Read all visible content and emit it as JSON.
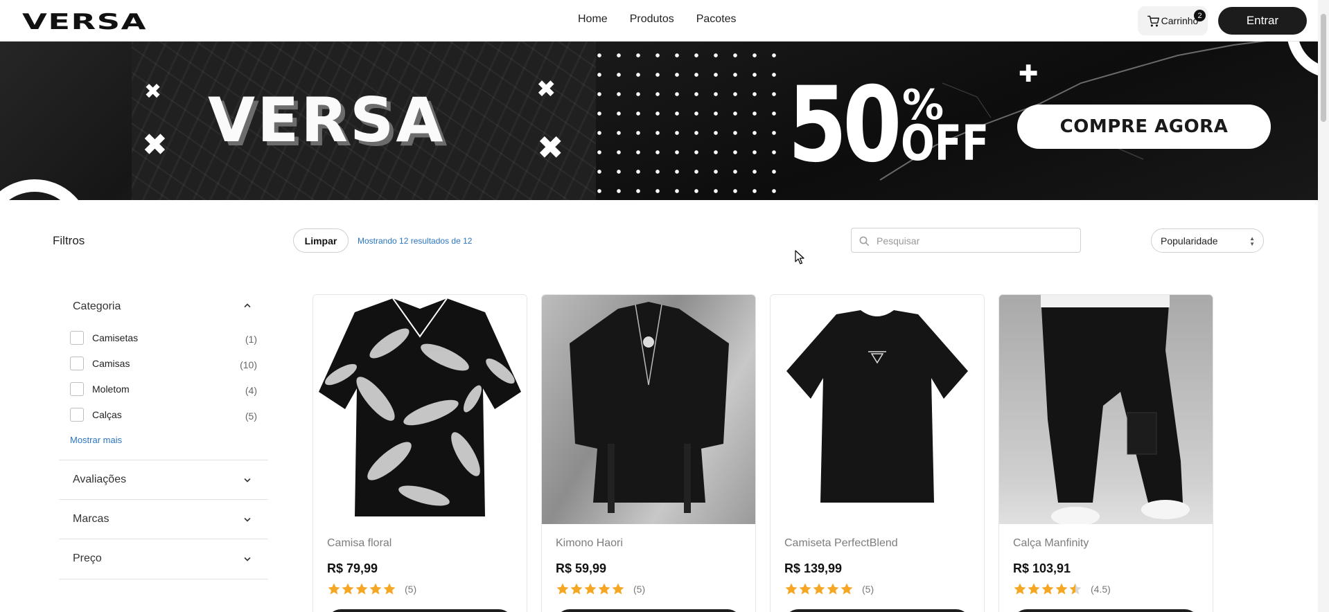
{
  "header": {
    "logo": "VERSA",
    "nav": [
      "Home",
      "Produtos",
      "Pacotes"
    ],
    "cart_label": "Carrinho",
    "cart_count": "2",
    "login_label": "Entrar"
  },
  "banner": {
    "brand": "VERSA",
    "discount_number": "50",
    "discount_symbol": "%",
    "discount_word": "OFF",
    "cta_label": "COMPRE AGORA"
  },
  "toolbar": {
    "filters_title": "Filtros",
    "clear_label": "Limpar",
    "results_text": "Mostrando 12 resultados de 12",
    "search_placeholder": "Pesquisar",
    "sort_selected": "Popularidade"
  },
  "sidebar": {
    "category_title": "Categoria",
    "categories": [
      {
        "label": "Camisetas",
        "count": "(1)"
      },
      {
        "label": "Camisas",
        "count": "(10)"
      },
      {
        "label": "Moletom",
        "count": "(4)"
      },
      {
        "label": "Calças",
        "count": "(5)"
      }
    ],
    "show_more": "Mostrar mais",
    "sections": [
      "Avaliações",
      "Marcas",
      "Preço"
    ]
  },
  "products": [
    {
      "name": "Camisa floral",
      "price": "R$ 79,99",
      "rating": 5,
      "rating_text": "(5)"
    },
    {
      "name": "Kimono Haori",
      "price": "R$ 59,99",
      "rating": 5,
      "rating_text": "(5)"
    },
    {
      "name": "Camiseta PerfectBlend",
      "price": "R$ 139,99",
      "rating": 5,
      "rating_text": "(5)"
    },
    {
      "name": "Calça Manfinity",
      "price": "R$ 103,91",
      "rating": 4.5,
      "rating_text": "(4.5)"
    }
  ],
  "colors": {
    "accent_link": "#2a75c0",
    "star": "#f5a623",
    "dark_button": "#1c1c1c"
  }
}
